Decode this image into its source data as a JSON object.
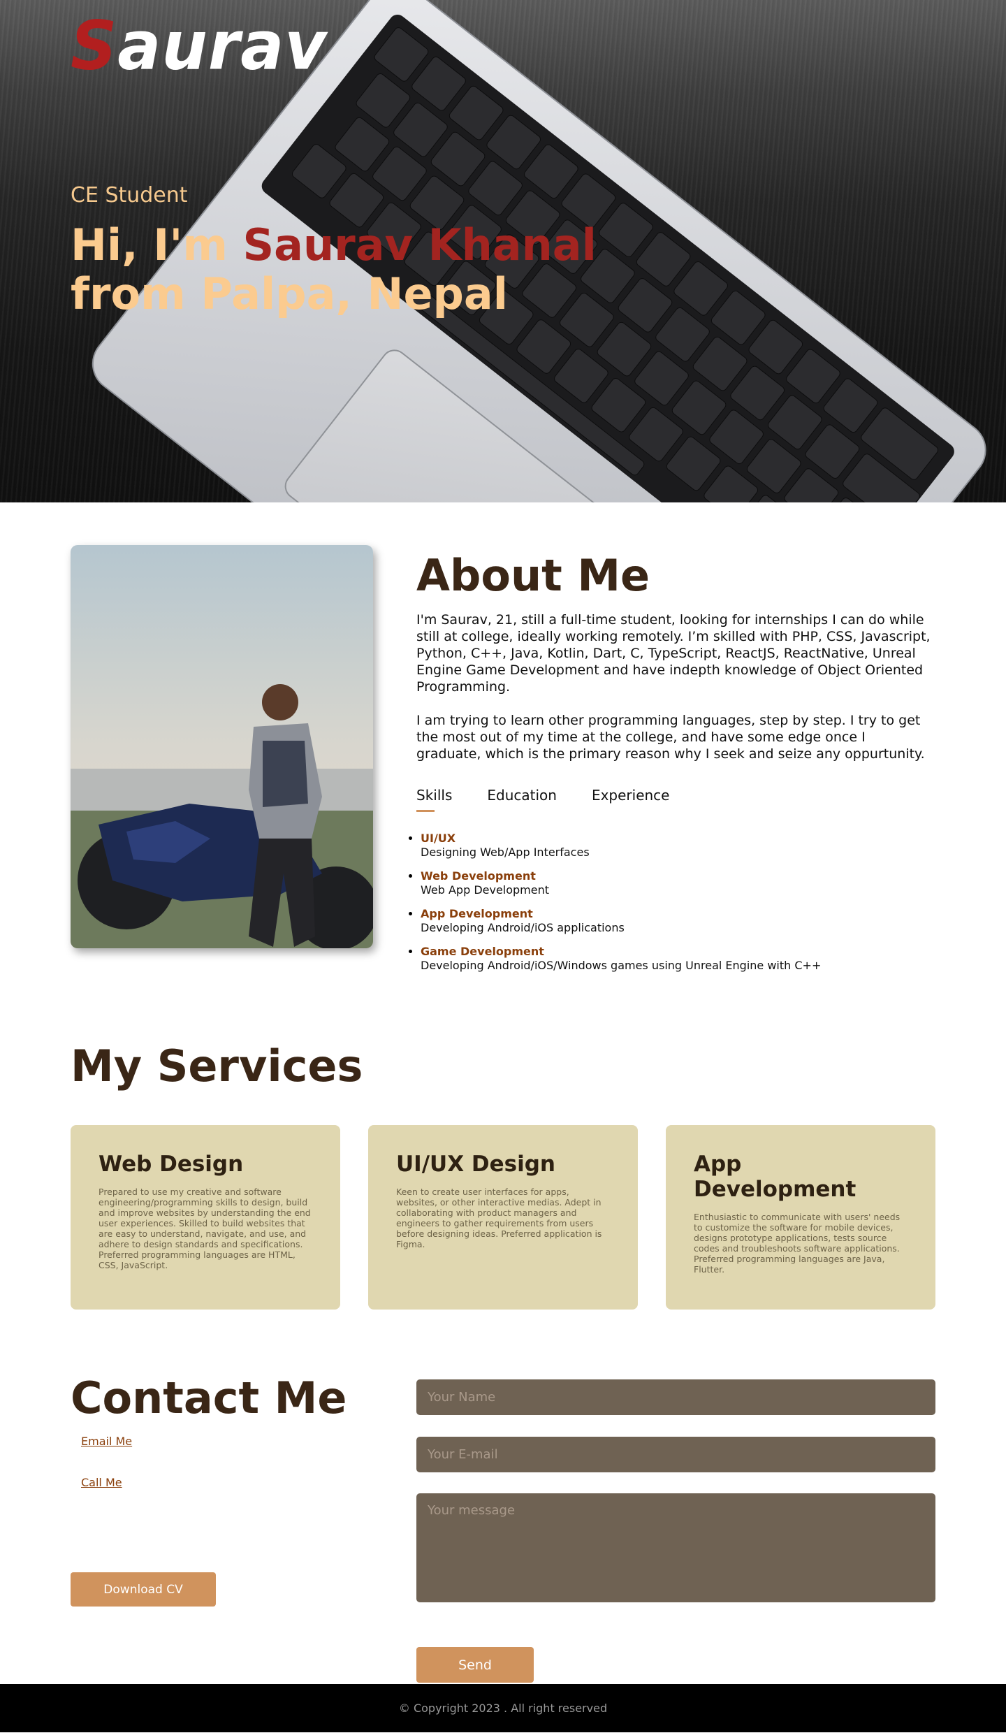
{
  "header": {
    "logo_first": "S",
    "logo_rest": "aurav",
    "subtitle": "CE Student",
    "title_prefix": "Hi, I'm ",
    "title_name": "Saurav Khanal",
    "title_line2": "from Palpa, Nepal"
  },
  "about": {
    "heading": "About Me",
    "paragraph1": "I'm Saurav, 21, still a full-time student, looking for internships I can do while still at college, ideally working remotely. I’m skilled with PHP, CSS, Javascript, Python, C++, Java, Kotlin, Dart, C, TypeScript, ReactJS, ReactNative, Unreal Engine Game Development and have indepth knowledge of Object Oriented Programming.",
    "paragraph2": "I am trying to learn other programming languages, step by step. I try to get the most out of my time at the college, and have some edge once I graduate, which is the primary reason why I seek and seize any oppurtunity.",
    "tabs": [
      {
        "label": "Skills",
        "active": true
      },
      {
        "label": "Education",
        "active": false
      },
      {
        "label": "Experience",
        "active": false
      }
    ],
    "skills": [
      {
        "title": "UI/UX",
        "desc": "Designing Web/App Interfaces"
      },
      {
        "title": "Web Development",
        "desc": "Web App Development"
      },
      {
        "title": "App Development",
        "desc": "Developing Android/iOS applications"
      },
      {
        "title": "Game Development",
        "desc": "Developing Android/iOS/Windows games using Unreal Engine with C++"
      }
    ]
  },
  "services": {
    "heading": "My Services",
    "cards": [
      {
        "title": "Web Design",
        "desc": "Prepared to use my creative and software engineering/programming skills to design, build and improve websites by understanding the end user experiences. Skilled to build websites that are easy to understand, navigate, and use, and adhere to design standards and specifications. Preferred programming languages are HTML, CSS, JavaScript."
      },
      {
        "title": "UI/UX Design",
        "desc": "Keen to create user interfaces for apps, websites, or other interactive medias. Adept in collaborating with product managers and engineers to gather requirements from users before designing ideas. Preferred application is Figma."
      },
      {
        "title": "App Development",
        "desc": "Enthusiastic to communicate with users' needs to customize the software for mobile devices, designs prototype applications, tests source codes and troubleshoots software applications. Preferred programming languages are Java, Flutter."
      }
    ]
  },
  "contact": {
    "heading": "Contact Me",
    "email_link": "Email Me",
    "call_link": "Call Me",
    "download_cv": "Download CV",
    "name_placeholder": "Your Name",
    "email_placeholder": "Your E-mail",
    "message_placeholder": "Your message",
    "send": "Send"
  },
  "footer": {
    "copyright": "© Copyright 2023 . All right reserved"
  },
  "colors": {
    "accent": "#d0935d",
    "heading": "#3a2616",
    "name_red": "#a32420",
    "card_bg": "#e0d7b0",
    "field_bg": "#6f6253"
  }
}
